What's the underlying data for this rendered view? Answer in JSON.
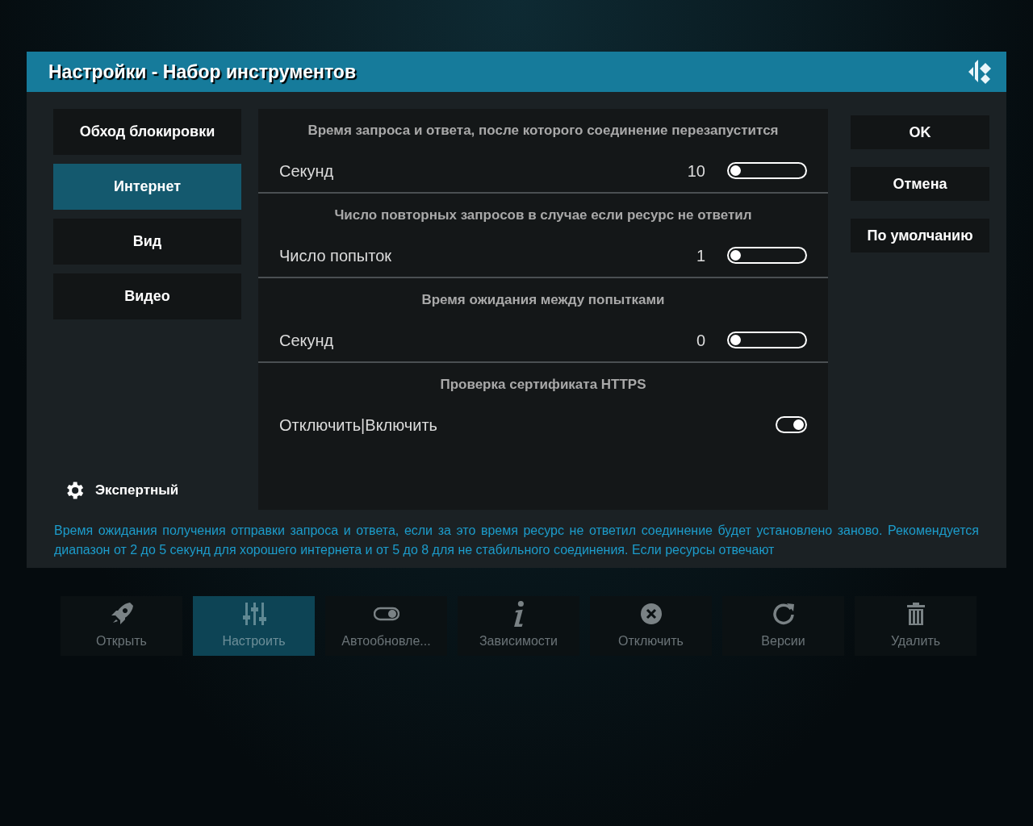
{
  "dialog": {
    "title": "Настройки - Набор инструментов"
  },
  "categories": [
    {
      "label": "Обход блокировки",
      "selected": false
    },
    {
      "label": "Интернет",
      "selected": true
    },
    {
      "label": "Вид",
      "selected": false
    },
    {
      "label": "Видео",
      "selected": false
    }
  ],
  "settings": [
    {
      "kind": "slider",
      "heading": "Время запроса и ответа, после которого соединение перезапустится",
      "label": "Секунд",
      "value": "10",
      "level": 0
    },
    {
      "kind": "slider",
      "heading": "Число повторных запросов в случае если ресурс не ответил",
      "label": "Число попыток",
      "value": "1",
      "level": 0
    },
    {
      "kind": "slider",
      "heading": "Время ожидания между попытками",
      "label": "Секунд",
      "value": "0",
      "level": 0
    },
    {
      "kind": "toggle",
      "heading": "Проверка сертификата HTTPS",
      "label": "Отключить|Включить",
      "on": true
    }
  ],
  "buttons": [
    "OK",
    "Отмена",
    "По умолчанию"
  ],
  "level_button": {
    "label": "Экспертный"
  },
  "description": "Время ожидания получения отправки запроса и ответа, если за это время ресурс не ответил соединение будет установлено заново. Рекомендуется диапазон от 2 до 5 секунд для хорошего интернета и от 5 до 8 для не стабильного соединения. Если ресурсы отвечают",
  "toolbar": [
    {
      "kind": "rocket",
      "label": "Открыть",
      "selected": false
    },
    {
      "kind": "sliders",
      "label": "Настроить",
      "selected": true
    },
    {
      "kind": "switch",
      "label": "Автообновле...",
      "selected": false
    },
    {
      "kind": "info",
      "label": "Зависимости",
      "selected": false
    },
    {
      "kind": "close",
      "label": "Отключить",
      "selected": false
    },
    {
      "kind": "refresh",
      "label": "Версии",
      "selected": false
    },
    {
      "kind": "trash",
      "label": "Удалить",
      "selected": false
    }
  ]
}
